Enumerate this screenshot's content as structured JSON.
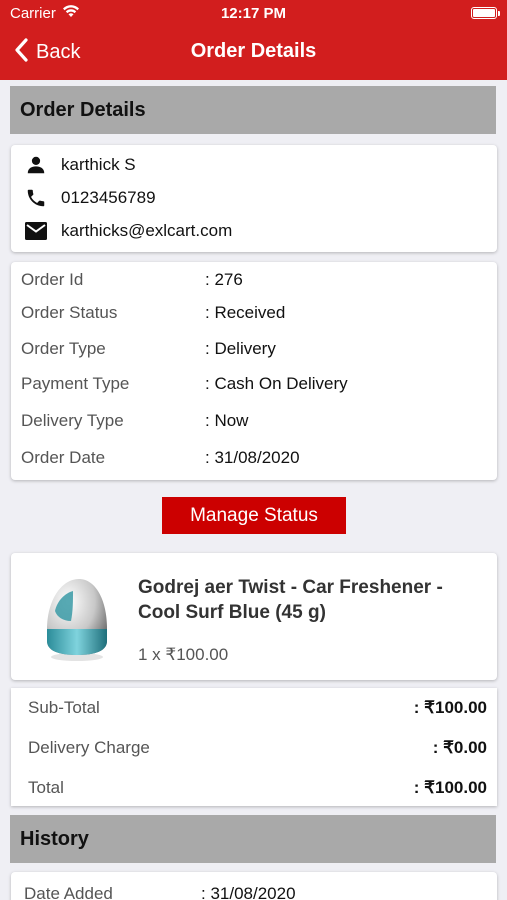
{
  "status_bar": {
    "carrier": "Carrier",
    "time": "12:17 PM"
  },
  "nav": {
    "back_label": "Back",
    "title": "Order Details"
  },
  "order_section": {
    "title": "Order Details"
  },
  "customer": {
    "name": "karthick  S",
    "phone": "0123456789",
    "email": "karthicks@exlcart.com"
  },
  "order_info": [
    {
      "label": "Order Id",
      "value": ": 276"
    },
    {
      "label": "Order Status",
      "value": ": Received"
    },
    {
      "label": "Order Type",
      "value": ": Delivery"
    },
    {
      "label": "Payment Type",
      "value": ": Cash On Delivery"
    },
    {
      "label": "Delivery Type",
      "value": ": Now"
    },
    {
      "label": "Order Date",
      "value": ": 31/08/2020"
    }
  ],
  "manage_button": {
    "label": "Manage Status"
  },
  "product": {
    "name": "Godrej aer Twist - Car Freshener - Cool Surf Blue (45 g)",
    "qty_price": "1 x ₹100.00"
  },
  "totals": [
    {
      "label": "Sub-Total",
      "value": ": ₹100.00"
    },
    {
      "label": "Delivery Charge",
      "value": ": ₹0.00"
    },
    {
      "label": "Total",
      "value": ": ₹100.00"
    }
  ],
  "history_section": {
    "title": "History"
  },
  "history": [
    {
      "label": "Date Added",
      "value": ": 31/08/2020"
    }
  ],
  "colors": {
    "accent": "#d21e1e",
    "button": "#cc0000",
    "section_header": "#a9a9a9",
    "background": "#efeff4"
  }
}
